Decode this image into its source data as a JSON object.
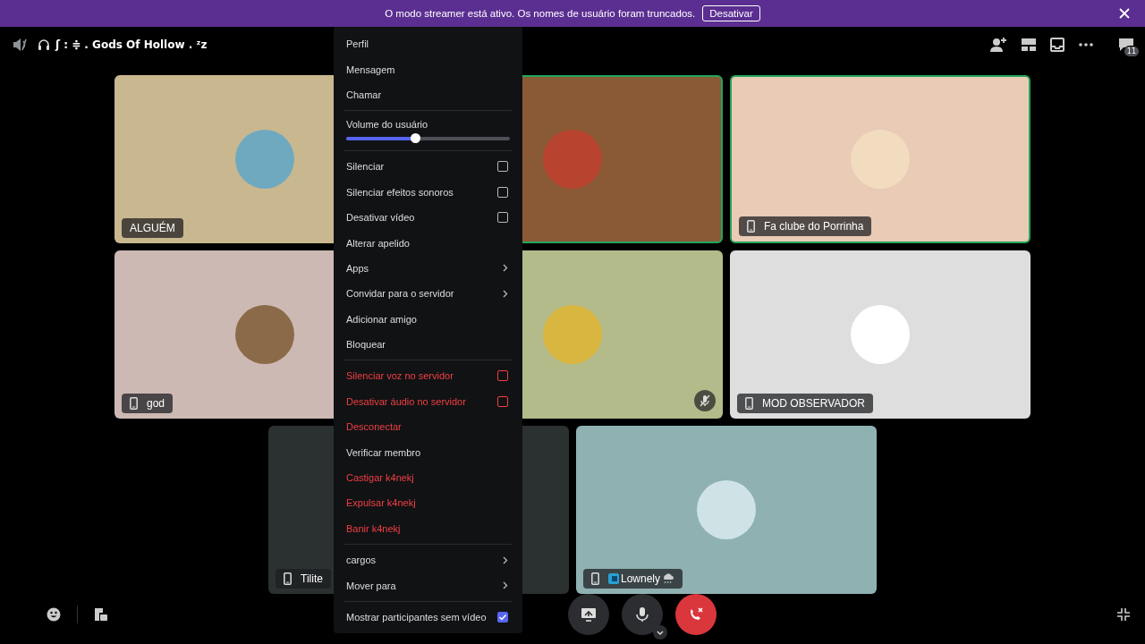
{
  "banner": {
    "message": "O modo streamer está ativo. Os nomes de usuário foram truncados.",
    "button": "Desativar"
  },
  "header": {
    "channel_name": "ʃ : ≑ . Gods Of Hollow . ᶻz",
    "chat_badge": "11"
  },
  "tiles": [
    {
      "name": "ALGUÉM",
      "speaking": false,
      "mobile": false
    },
    {
      "speaking": true,
      "muted": false
    },
    {
      "name": "Fa clube do Porrinha",
      "speaking": true,
      "mobile": true,
      "muted": false
    },
    {
      "name": "god",
      "speaking": false,
      "mobile": true,
      "muted": false
    },
    {
      "speaking": false,
      "muted": true
    },
    {
      "name": "MOD OBSERVADOR",
      "speaking": false,
      "mobile": true,
      "muted": false
    },
    {
      "name": "Tilite",
      "speaking": false,
      "mobile": true,
      "muted": false
    },
    {
      "name": "Lownely",
      "speaking": false,
      "mobile": true,
      "muted": false
    }
  ],
  "menu": {
    "groups": [
      [
        {
          "kind": "action",
          "label": "Perfil",
          "danger": false
        },
        {
          "kind": "action",
          "label": "Mensagem",
          "danger": false
        },
        {
          "kind": "action",
          "label": "Chamar",
          "danger": false
        }
      ],
      [
        {
          "kind": "slider",
          "label": "Volume do usuário",
          "level": 0.42
        }
      ],
      [
        {
          "kind": "checkbox",
          "label": "Silenciar",
          "danger": false,
          "checked": false
        },
        {
          "kind": "checkbox",
          "label": "Silenciar efeitos sonoros",
          "danger": false,
          "checked": false
        },
        {
          "kind": "checkbox",
          "label": "Desativar vídeo",
          "danger": false,
          "checked": false
        },
        {
          "kind": "action",
          "label": "Alterar apelido",
          "danger": false
        },
        {
          "kind": "submenu",
          "label": "Apps",
          "danger": false
        },
        {
          "kind": "submenu",
          "label": "Convidar para o servidor",
          "danger": false
        },
        {
          "kind": "action",
          "label": "Adicionar amigo",
          "danger": false
        },
        {
          "kind": "action",
          "label": "Bloquear",
          "danger": false
        }
      ],
      [
        {
          "kind": "checkbox",
          "label": "Silenciar voz no servidor",
          "danger": true,
          "checked": false
        },
        {
          "kind": "checkbox",
          "label": "Desativar áudio no servidor",
          "danger": true,
          "checked": false
        },
        {
          "kind": "action",
          "label": "Desconectar",
          "danger": true
        },
        {
          "kind": "action",
          "label": "Verificar membro",
          "danger": false
        },
        {
          "kind": "action",
          "label": "Castigar k4nekj",
          "danger": true
        },
        {
          "kind": "action",
          "label": "Expulsar k4nekj",
          "danger": true
        },
        {
          "kind": "action",
          "label": "Banir k4nekj",
          "danger": true
        }
      ],
      [
        {
          "kind": "submenu",
          "label": "cargos",
          "danger": false
        },
        {
          "kind": "submenu",
          "label": "Mover para",
          "danger": false
        }
      ],
      [
        {
          "kind": "checkbox",
          "label": "Mostrar participantes sem vídeo",
          "danger": false,
          "checked": true
        }
      ]
    ]
  }
}
